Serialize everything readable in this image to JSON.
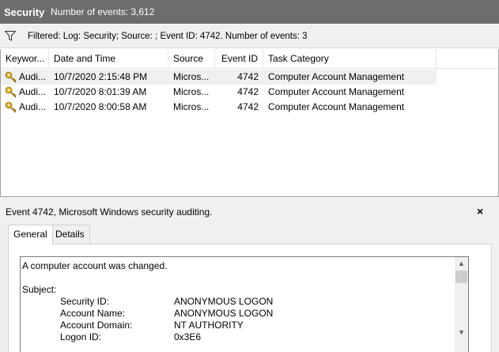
{
  "header": {
    "log_name": "Security",
    "event_count": "Number of events: 3,612"
  },
  "filter": {
    "text": "Filtered: Log: Security; Source: ; Event ID: 4742. Number of events: 3",
    "icon": "funnel-icon"
  },
  "grid": {
    "columns": [
      "Keywor...",
      "Date and Time",
      "Source",
      "Event ID",
      "Task Category"
    ],
    "rows": [
      {
        "keyword": "Audi...",
        "datetime": "10/7/2020 2:15:48 PM",
        "source": "Micros...",
        "event_id": "4742",
        "task_category": "Computer Account Management",
        "icon": "key-icon",
        "selected": true
      },
      {
        "keyword": "Audi...",
        "datetime": "10/7/2020 8:01:39 AM",
        "source": "Micros...",
        "event_id": "4742",
        "task_category": "Computer Account Management",
        "icon": "key-icon",
        "selected": false
      },
      {
        "keyword": "Audi...",
        "datetime": "10/7/2020 8:00:58 AM",
        "source": "Micros...",
        "event_id": "4742",
        "task_category": "Computer Account Management",
        "icon": "key-icon",
        "selected": false
      }
    ]
  },
  "detail": {
    "title": "Event 4742, Microsoft Windows security auditing.",
    "close_label": "×",
    "tabs": [
      "General",
      "Details"
    ],
    "active_tab": "General",
    "description": "A computer account was changed.",
    "subject_label": "Subject:",
    "fields": [
      {
        "label": "Security ID:",
        "value": "ANONYMOUS LOGON"
      },
      {
        "label": "Account Name:",
        "value": "ANONYMOUS LOGON"
      },
      {
        "label": "Account Domain:",
        "value": "NT AUTHORITY"
      },
      {
        "label": "Logon ID:",
        "value": "0x3E6"
      }
    ],
    "scroll_up": "▲",
    "scroll_down": "▼"
  },
  "colors": {
    "titlebar_bg": "#6d6d6d",
    "panel_bg": "#f0f0f0",
    "selected_row_bg": "#f0f0f0",
    "key_icon": "#d4a017"
  }
}
